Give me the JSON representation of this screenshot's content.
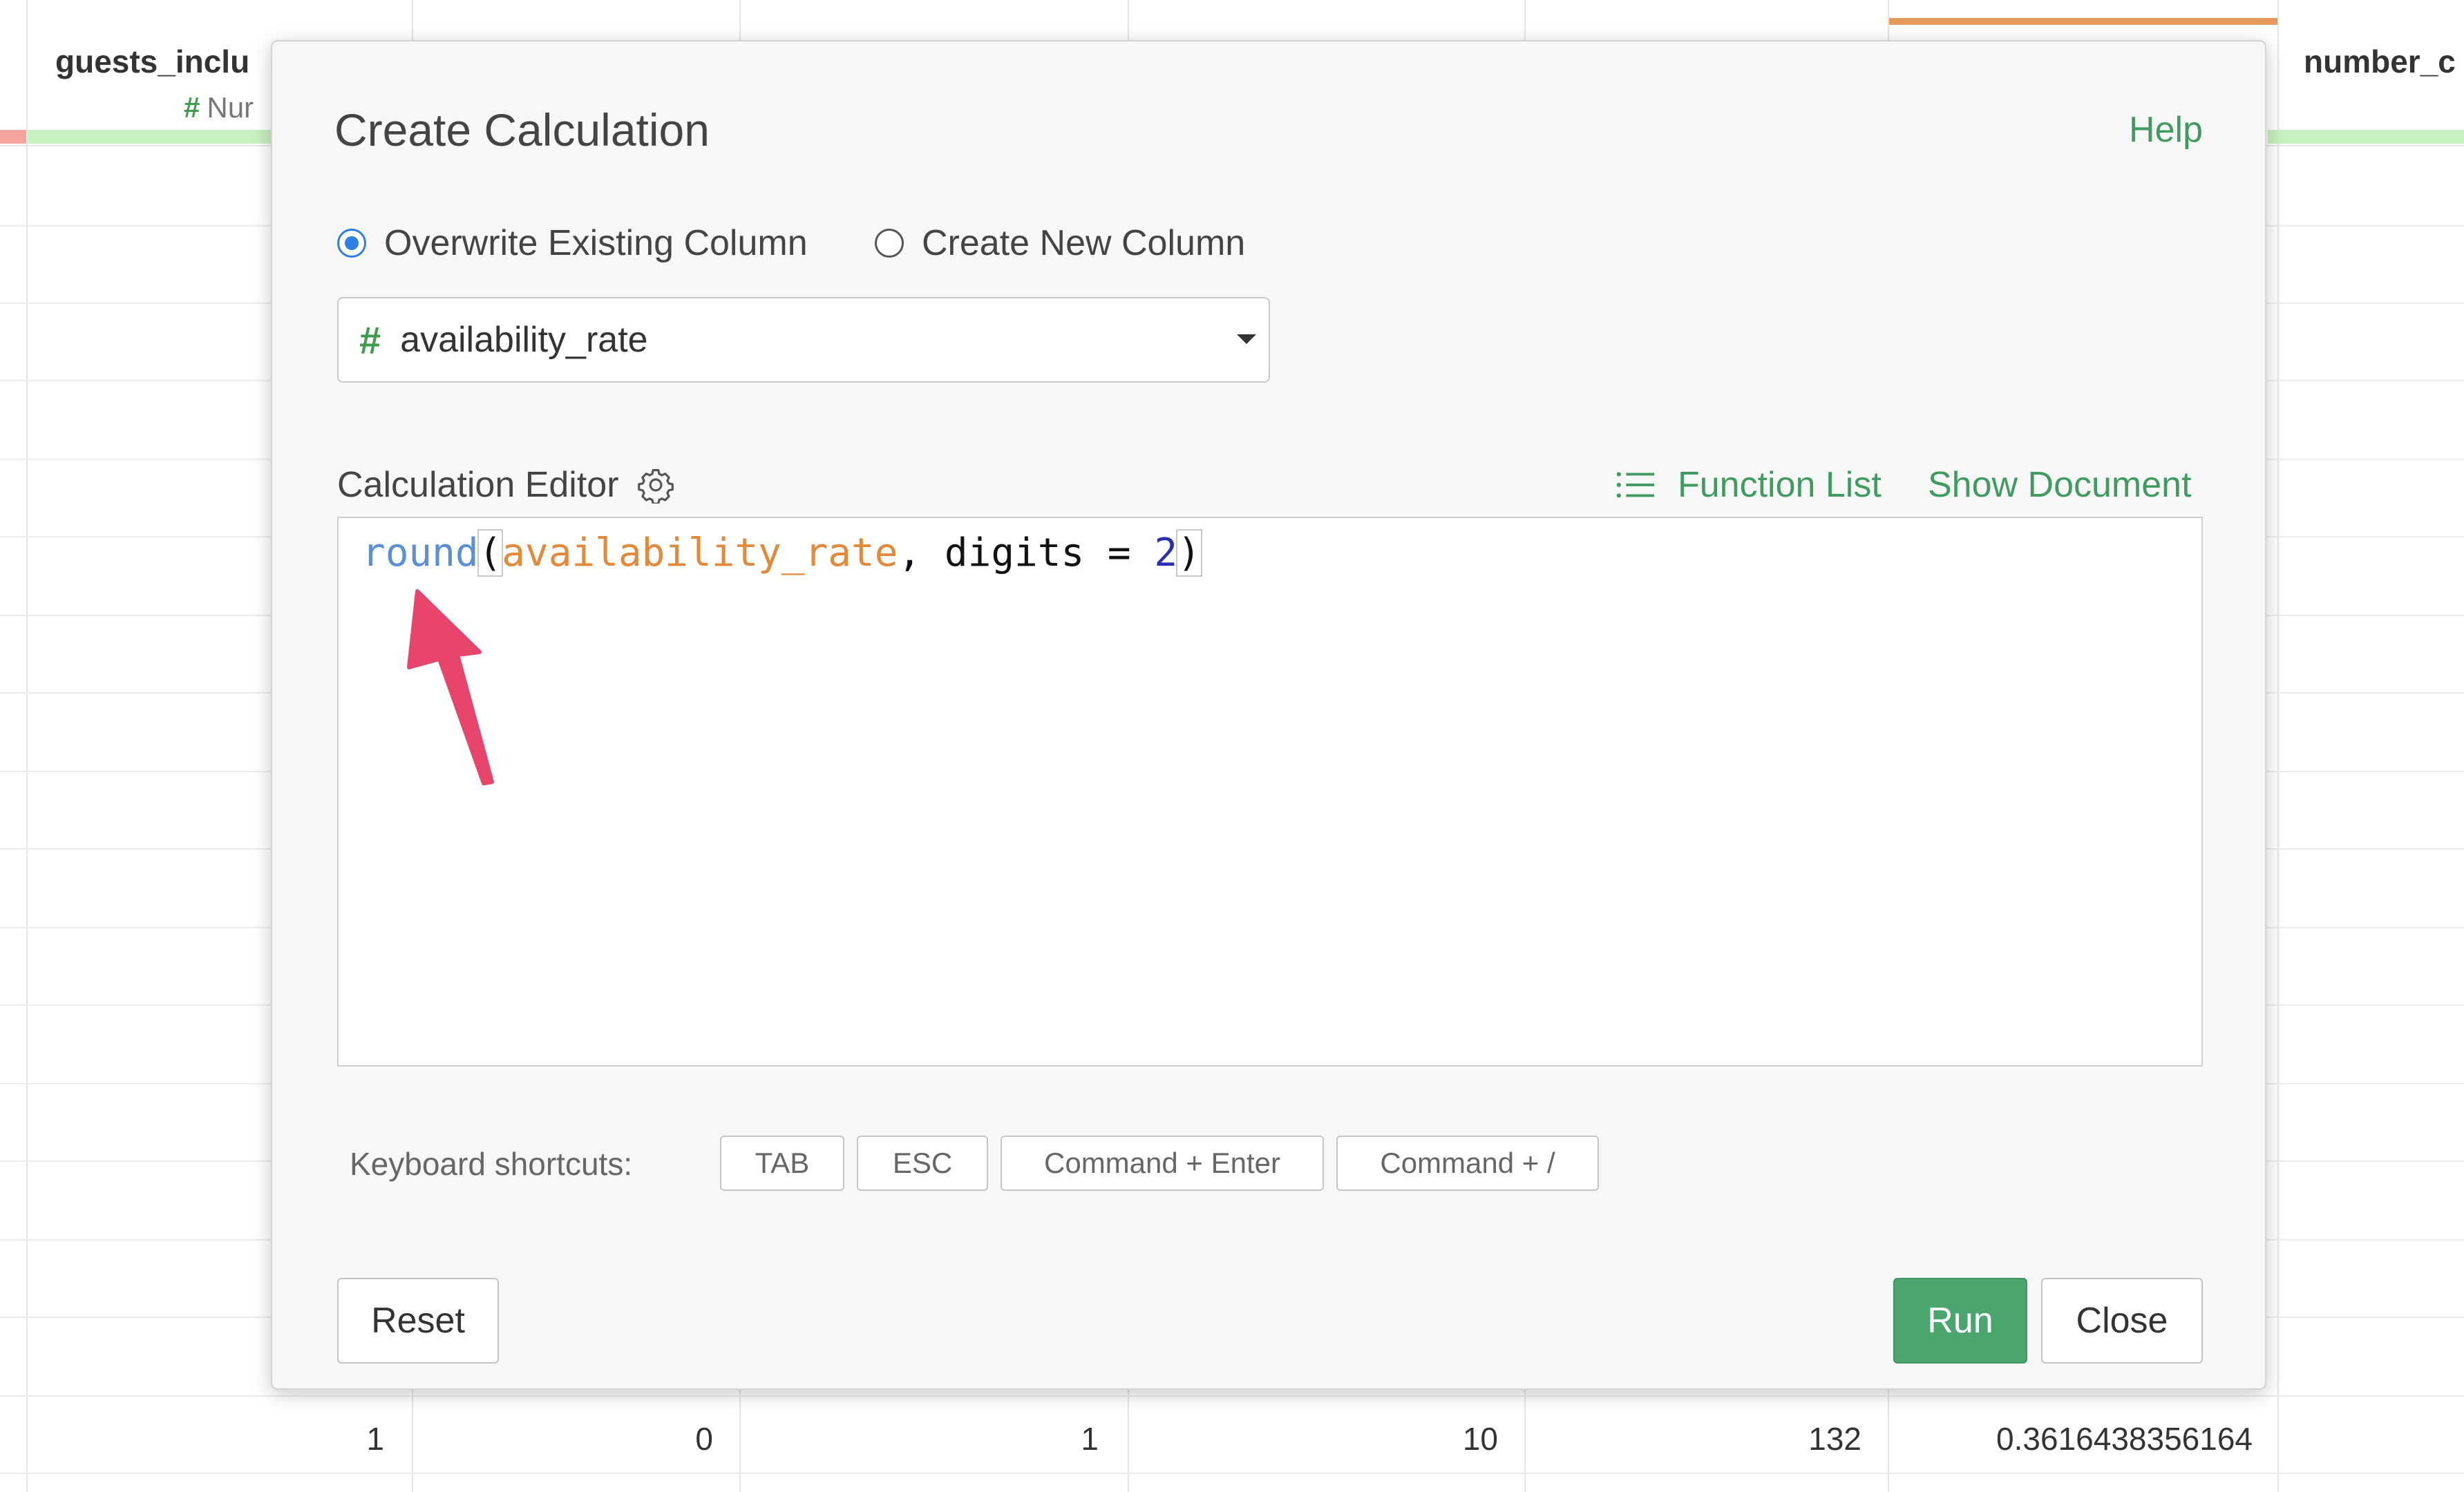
{
  "grid": {
    "headers": [
      {
        "title": "guests_inclu",
        "type": "Nur"
      },
      {
        "title": "number_c"
      }
    ],
    "row": [
      "1",
      "0",
      "1",
      "10",
      "132",
      "0.3616438356164"
    ]
  },
  "modal": {
    "title": "Create Calculation",
    "help": "Help",
    "radio_overwrite": "Overwrite Existing Column",
    "radio_new": "Create New Column",
    "selected_column": "availability_rate",
    "editor_label": "Calculation Editor",
    "function_list": "Function List",
    "show_document": "Show Document",
    "code": {
      "fn": "round",
      "open": "(",
      "column": "availability_rate",
      "rest": ", digits = ",
      "number": "2",
      "close": ")"
    },
    "shortcuts_label": "Keyboard shortcuts:",
    "shortcuts": [
      "TAB",
      "ESC",
      "Command + Enter",
      "Command + /"
    ],
    "reset": "Reset",
    "run": "Run",
    "close": "Close"
  },
  "colors": {
    "accent_green": "#4aa56f",
    "link_green": "#3f9b5f",
    "radio_blue": "#2f7ee6",
    "annotation_arrow": "#e8456c"
  },
  "icons": [
    "hash-icon",
    "gear-icon",
    "list-icon",
    "dropdown-caret-icon"
  ]
}
